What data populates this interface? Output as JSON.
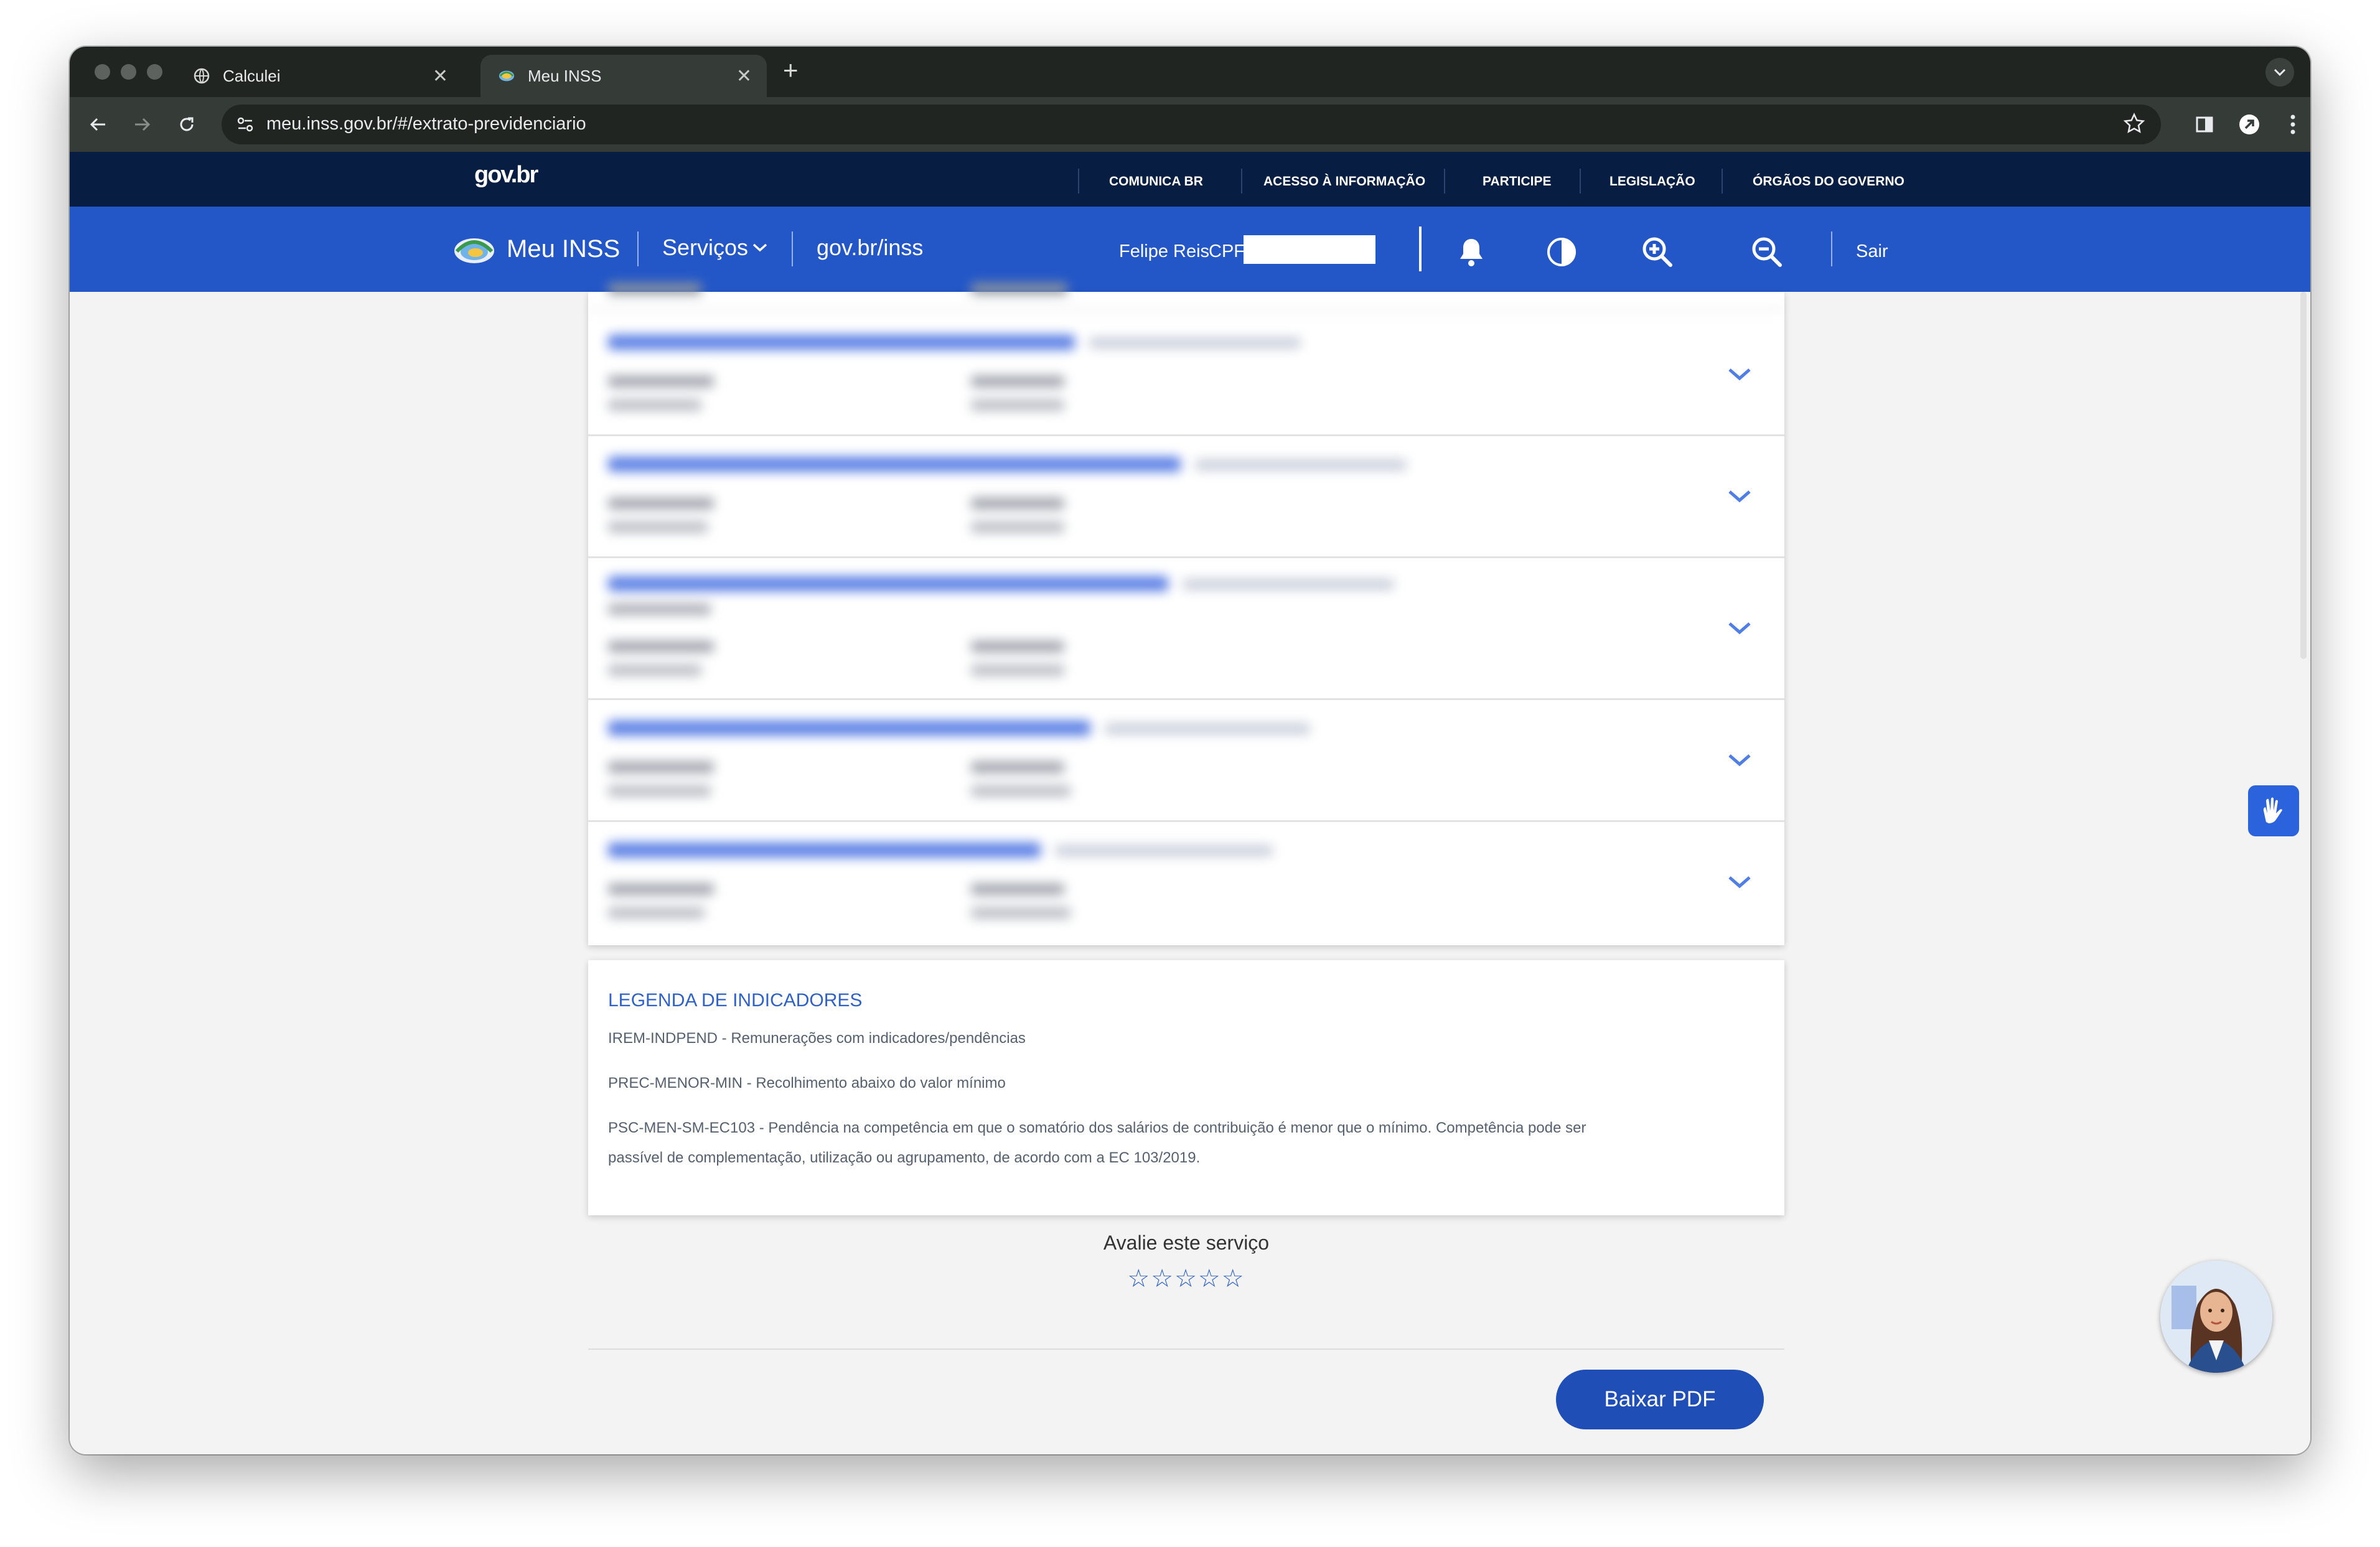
{
  "browser": {
    "tabs": [
      {
        "title": "Calculei",
        "icon": "globe-icon",
        "active": false
      },
      {
        "title": "Meu INSS",
        "icon": "inss-logo-icon",
        "active": true
      }
    ],
    "close_glyph": "✕",
    "new_tab_glyph": "+",
    "url": "meu.inss.gov.br/#/extrato-previdenciario"
  },
  "govbar": {
    "logo": "gov.br",
    "links": [
      "COMUNICA BR",
      "ACESSO À INFORMAÇÃO",
      "PARTICIPE",
      "LEGISLAÇÃO",
      "ÓRGÃOS DO GOVERNO"
    ]
  },
  "inss_header": {
    "app_name": "Meu INSS",
    "services_label": "Serviços",
    "site_link": "gov.br/inss",
    "user_name": "Felipe Reis",
    "cpf_label": "CPF:",
    "logout_label": "Sair"
  },
  "employment_records": {
    "partial_row": "12/12/2012   19/06/2014",
    "rows": [
      {
        "blurred": true
      },
      {
        "blurred": true
      },
      {
        "blurred": true,
        "has_indicator": true
      },
      {
        "blurred": true
      },
      {
        "blurred": true
      }
    ]
  },
  "legend": {
    "title": "LEGENDA DE INDICADORES",
    "items": [
      "IREM-INDPEND - Remunerações com indicadores/pendências",
      "PREC-MENOR-MIN - Recolhimento abaixo do valor mínimo",
      "PSC-MEN-SM-EC103 - Pendência na competência em que o somatório dos salários de contribuição é menor que o mínimo. Competência pode ser",
      "passível de complementação, utilização ou agrupamento, de acordo com a EC 103/2019."
    ]
  },
  "rating": {
    "label": "Avalie este serviço",
    "stars": [
      "☆",
      "☆",
      "☆",
      "☆",
      "☆"
    ]
  },
  "actions": {
    "download_pdf": "Baixar PDF"
  },
  "colors": {
    "gov_bar": "#071d41",
    "inss_bar": "#2357c8",
    "link_blue": "#2f62c9",
    "button_blue": "#1f4fb6"
  }
}
